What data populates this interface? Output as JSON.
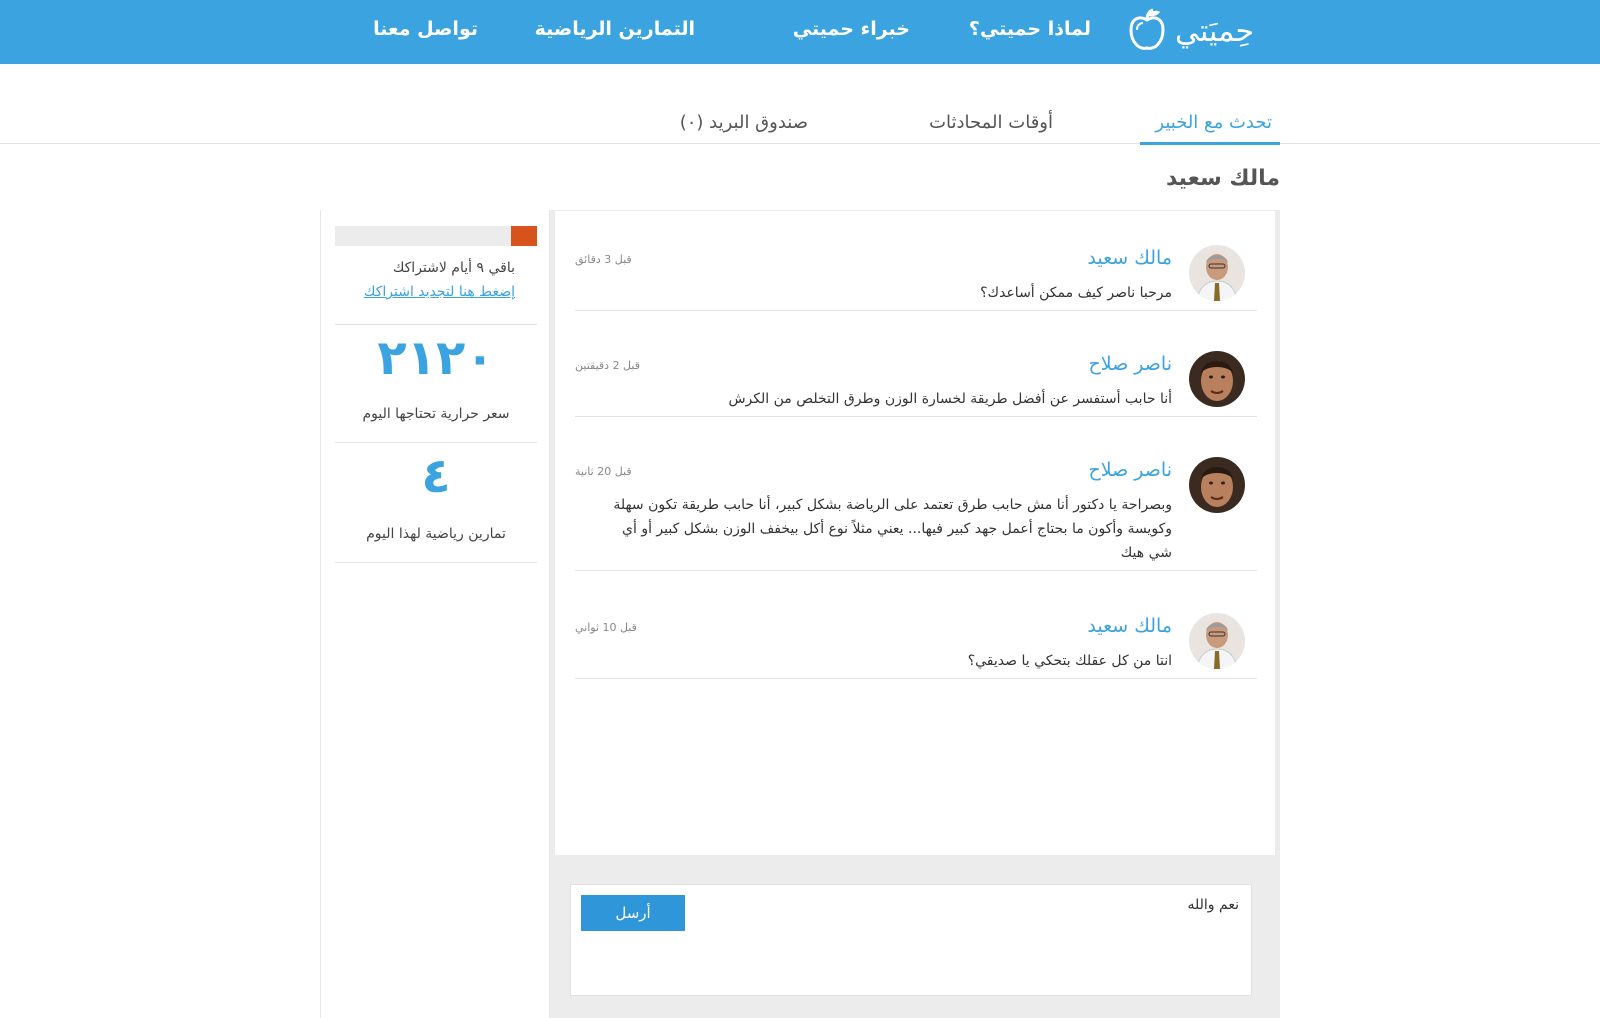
{
  "brand": {
    "name": "حِميَتي",
    "color": "#3ba3df"
  },
  "nav": [
    {
      "label": "لماذا حميتي؟"
    },
    {
      "label": "خبراء حميتي"
    },
    {
      "label": "التمارين الرياضية"
    },
    {
      "label": "تواصل معنا"
    }
  ],
  "tabs": [
    {
      "label": "تحدث مع الخبير",
      "active": true
    },
    {
      "label": "أوقات المحادثات",
      "active": false
    },
    {
      "label": "صندوق البريد (٠)",
      "active": false
    }
  ],
  "conversation": {
    "title": "مالك سعيد"
  },
  "sidebar": {
    "subscription": {
      "remaining_label": "باقي ٩ أيام لاشتراكك",
      "renew_link": "إضغط هنا لتجديد اشتراكك",
      "progress_fraction": 0.13,
      "progress_color": "#d8531c"
    },
    "stats": [
      {
        "value": "٢١٢٠",
        "label": "سعر حرارية تحتاجها اليوم"
      },
      {
        "value": "٤",
        "label": "تمارين رياضية لهذا اليوم"
      }
    ]
  },
  "messages": [
    {
      "sender": "مالك سعيد",
      "time": "قبل 3 دقائق",
      "text": "مرحبا ناصر كيف ممكن أساعدك؟",
      "avatar": "doctor-avatar"
    },
    {
      "sender": "ناصر صلاح",
      "time": "قبل 2 دقيقتين",
      "text": "أنا حابب أستفسر عن أفضل طريقة لخسارة الوزن وطرق التخلص من الكرش",
      "avatar": "user-avatar"
    },
    {
      "sender": "ناصر صلاح",
      "time": "قبل 20 ثانية",
      "text": "وبصراحة يا دكتور أنا مش حابب طرق تعتمد على الرياضة بشكل كبير، أنا حابب طريقة تكون سهلة وكويسة وأكون ما بحتاج أعمل جهد كبير فيها... يعني مثلاً نوع أكل بيخفف الوزن بشكل كبير أو أي شي هيك",
      "avatar": "user-avatar"
    },
    {
      "sender": "مالك سعيد",
      "time": "قبل 10 ثواني",
      "text": "انتا من كل عقلك بتحكي يا صديقي؟",
      "avatar": "doctor-avatar"
    }
  ],
  "composer": {
    "value": "نعم والله",
    "send_label": "أرسل"
  }
}
